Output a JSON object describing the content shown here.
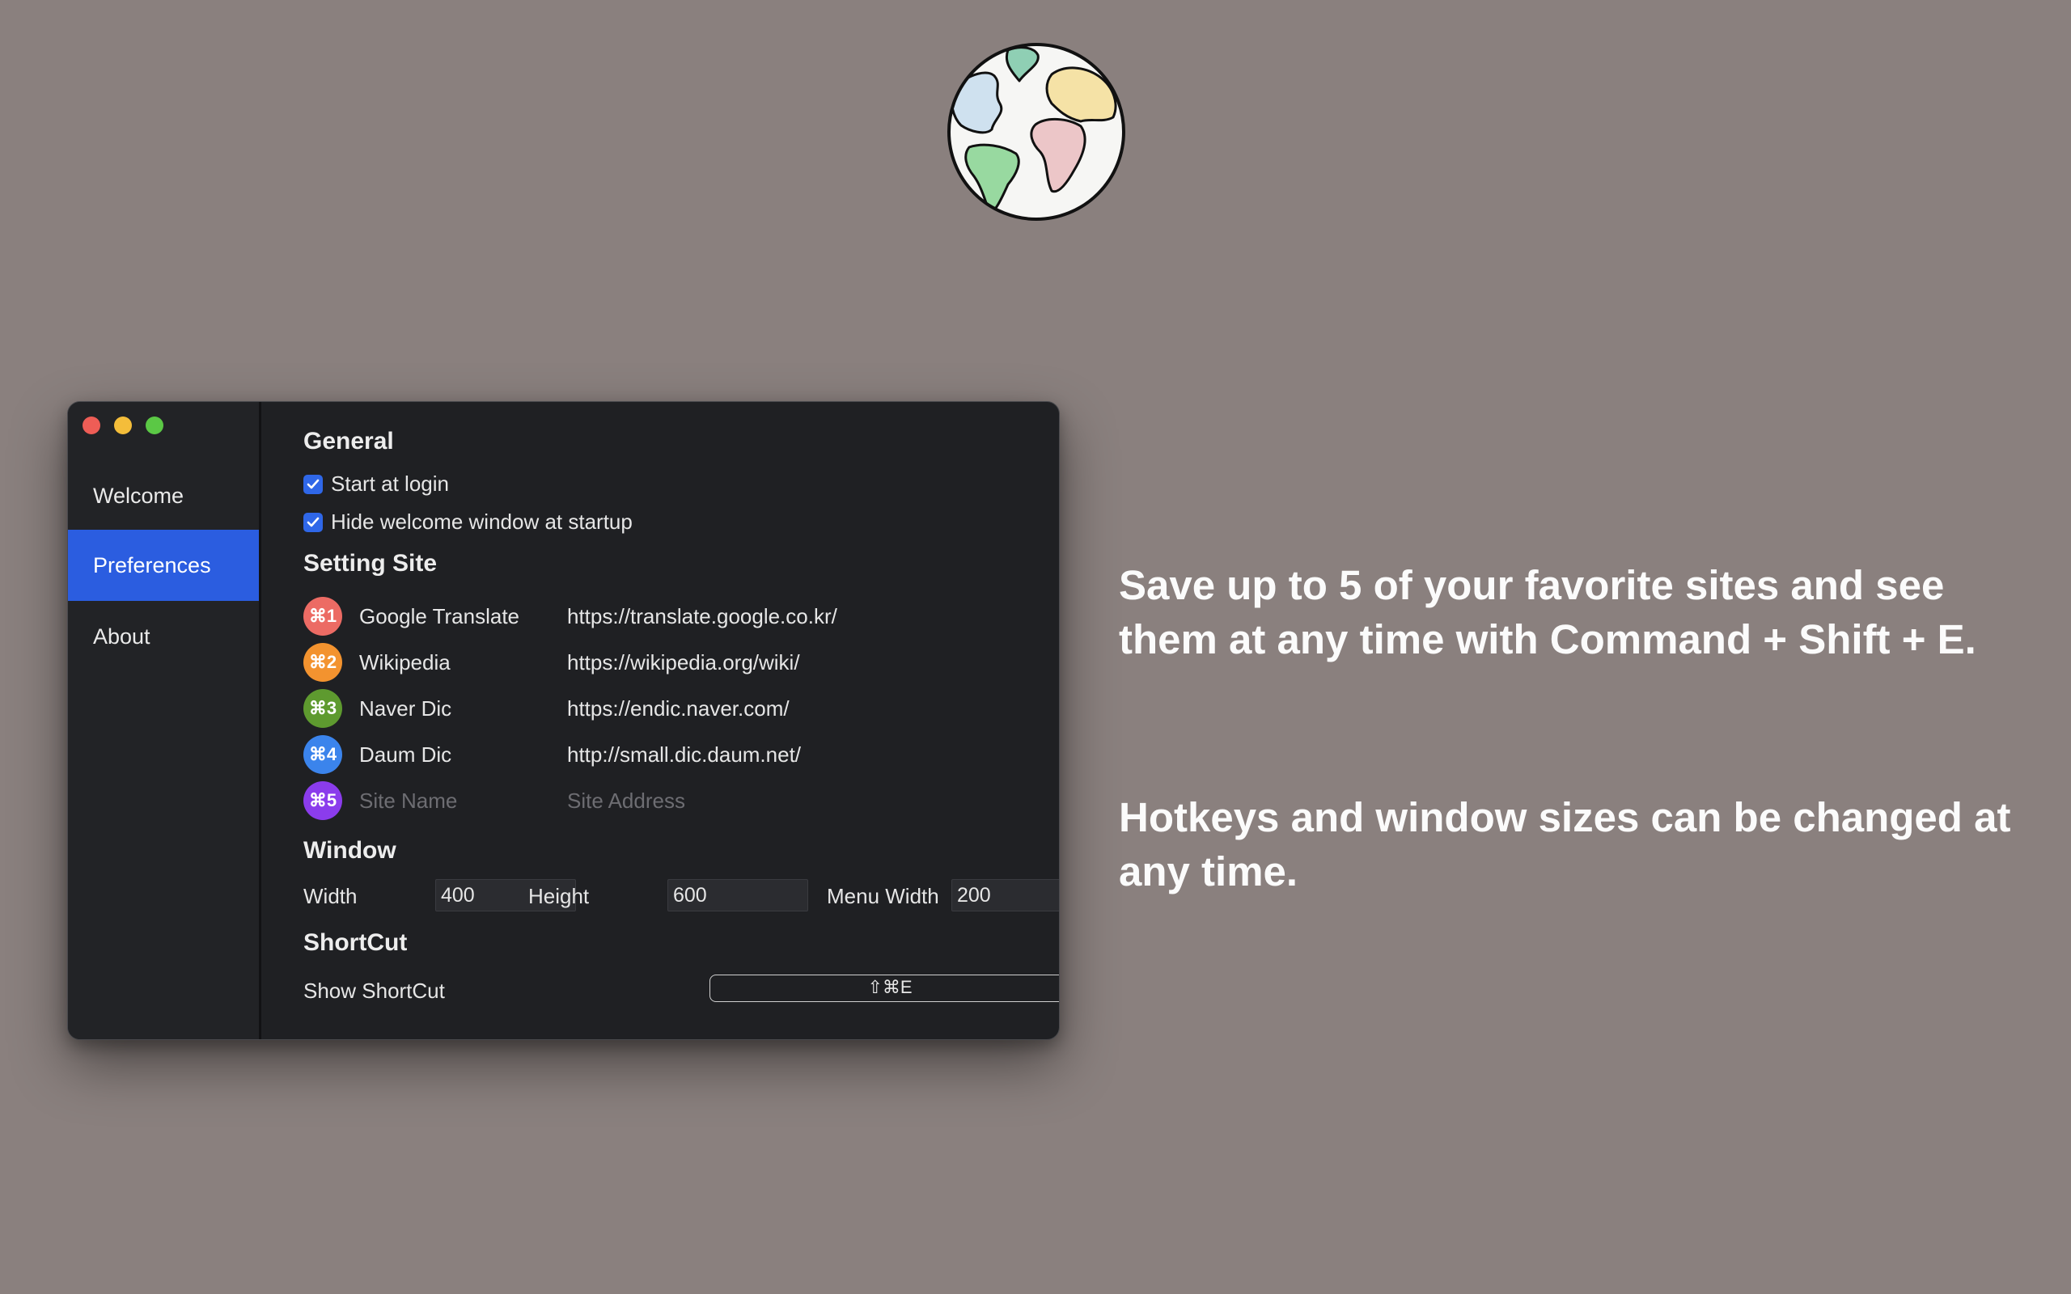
{
  "promo": {
    "paragraph1": "Save up to 5 of your favorite sites and see them at any time with Command + Shift + E.",
    "paragraph2": "Hotkeys and window sizes can be changed at any time."
  },
  "sidebar": {
    "items": [
      {
        "label": "Welcome",
        "active": false
      },
      {
        "label": "Preferences",
        "active": true
      },
      {
        "label": "About",
        "active": false
      }
    ]
  },
  "general": {
    "title": "General",
    "start_at_login": {
      "label": "Start at login",
      "checked": true
    },
    "hide_welcome": {
      "label": "Hide welcome window at startup",
      "checked": true
    }
  },
  "setting_site": {
    "title": "Setting Site",
    "sites": [
      {
        "hotkey": "⌘1",
        "color": "#ec6b64",
        "name": "Google Translate",
        "url": "https://translate.google.co.kr/"
      },
      {
        "hotkey": "⌘2",
        "color": "#f3932f",
        "name": "Wikipedia",
        "url": "https://wikipedia.org/wiki/"
      },
      {
        "hotkey": "⌘3",
        "color": "#5e9a2f",
        "name": "Naver Dic",
        "url": "https://endic.naver.com/"
      },
      {
        "hotkey": "⌘4",
        "color": "#3b84ec",
        "name": "Daum Dic",
        "url": "http://small.dic.daum.net/"
      },
      {
        "hotkey": "⌘5",
        "color": "#8b3cec",
        "name_placeholder": "Site Name",
        "url_placeholder": "Site Address"
      }
    ]
  },
  "window": {
    "title": "Window",
    "width_label": "Width",
    "width_value": "400",
    "height_label": "Height",
    "height_value": "600",
    "menu_width_label": "Menu Width",
    "menu_width_value": "200"
  },
  "shortcut": {
    "title": "ShortCut",
    "show_label": "Show ShortCut",
    "value": "⇧⌘E"
  }
}
